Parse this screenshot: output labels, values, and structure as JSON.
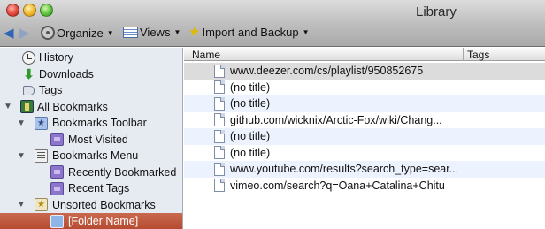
{
  "window": {
    "title": "Library"
  },
  "toolbar": {
    "back_icon": "back-arrow-icon",
    "forward_icon": "forward-arrow-icon",
    "organize_label": "Organize",
    "views_label": "Views",
    "import_label": "Import and Backup"
  },
  "sidebar": {
    "items": [
      {
        "label": "History",
        "icon": "clock-icon"
      },
      {
        "label": "Downloads",
        "icon": "download-arrow-icon"
      },
      {
        "label": "Tags",
        "icon": "tag-icon"
      },
      {
        "label": "All Bookmarks",
        "icon": "library-icon",
        "expanded": true
      },
      {
        "label": "Bookmarks Toolbar",
        "icon": "star-folder-icon",
        "expanded": true
      },
      {
        "label": "Most Visited",
        "icon": "smart-folder-icon"
      },
      {
        "label": "Bookmarks Menu",
        "icon": "menu-icon",
        "expanded": true
      },
      {
        "label": "Recently Bookmarked",
        "icon": "smart-folder-icon"
      },
      {
        "label": "Recent Tags",
        "icon": "smart-folder-icon"
      },
      {
        "label": "Unsorted Bookmarks",
        "icon": "unsorted-icon",
        "expanded": true
      },
      {
        "label": "[Folder Name]",
        "icon": "folder-icon",
        "selected": true
      }
    ]
  },
  "list": {
    "columns": [
      "Name",
      "Tags"
    ],
    "rows": [
      {
        "name": "www.deezer.com/cs/playlist/950852675"
      },
      {
        "name": "(no title)"
      },
      {
        "name": "(no title)"
      },
      {
        "name": "github.com/wicknix/Arctic-Fox/wiki/Chang..."
      },
      {
        "name": "(no title)"
      },
      {
        "name": "(no title)"
      },
      {
        "name": "www.youtube.com/results?search_type=sear..."
      },
      {
        "name": "vimeo.com/search?q=Oana+Catalina+Chitu"
      }
    ]
  },
  "colors": {
    "selection": "#b9553a",
    "sidebar_bg": "#e6ebf2",
    "alt_row": "#edf3fe"
  }
}
